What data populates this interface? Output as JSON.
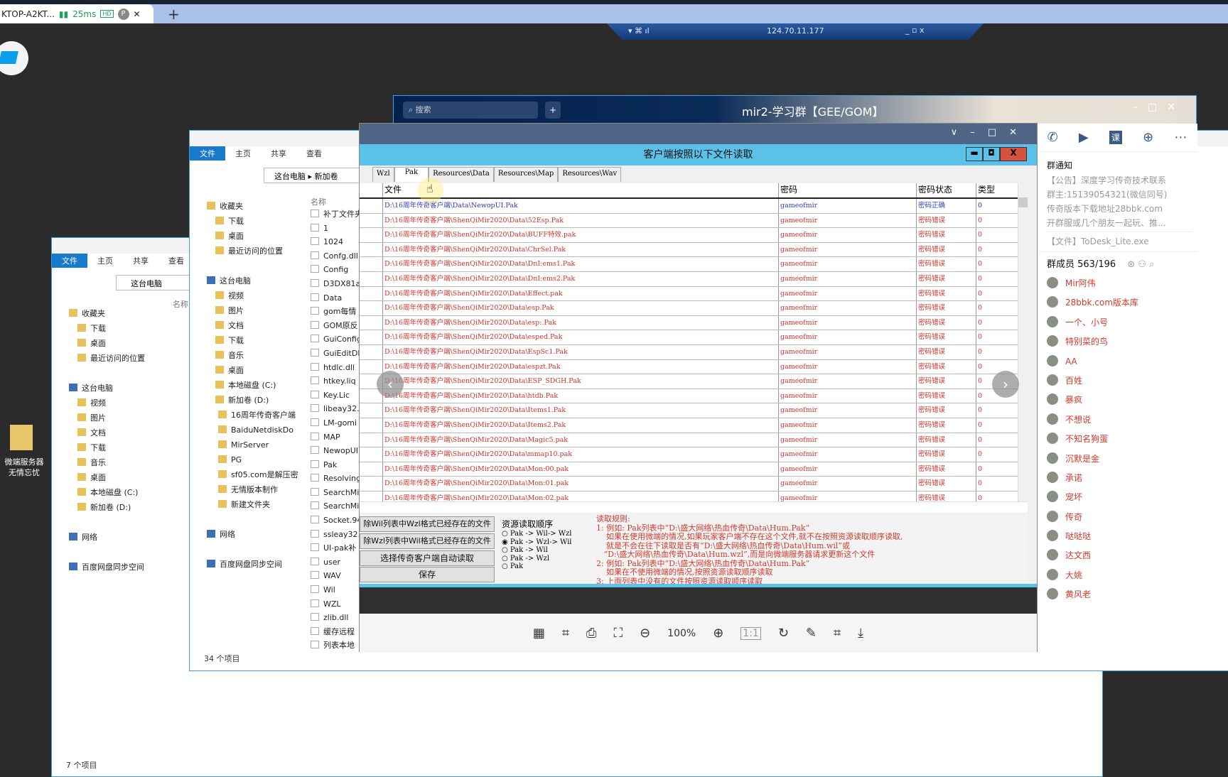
{
  "browser": {
    "tab_title": "KTOP-A2KT...",
    "ping": "25ms",
    "hd": "HD",
    "profile": "P",
    "close": "✕",
    "new_tab": "+"
  },
  "remote_bar": {
    "ip": "124.70.11.177",
    "controls": "_ ▫ x"
  },
  "desktop": {
    "icon_label_1": "微端服务器",
    "icon_label_2": "无情忘忧"
  },
  "explorer_back": {
    "ribbon": [
      "文件",
      "主页",
      "共享",
      "查看"
    ],
    "path": "这台电脑",
    "col": "名称",
    "nav": [
      "收藏夹",
      "下载",
      "桌面",
      "最近访问的位置",
      "",
      "这台电脑",
      "视频",
      "图片",
      "文档",
      "下载",
      "音乐",
      "桌面",
      "本地磁盘 (C:)",
      "新加卷 (D:)",
      "",
      "网络",
      "",
      "百度网盘同步空间"
    ],
    "status": "7 个项目"
  },
  "explorer": {
    "ribbon": [
      "文件",
      "主页",
      "共享",
      "查看"
    ],
    "path": "这台电脑 ▸ 新加卷",
    "col": "名称",
    "nav": [
      "收藏夹",
      "下载",
      "桌面",
      "最近访问的位置",
      "",
      "这台电脑",
      "视频",
      "图片",
      "文档",
      "下载",
      "音乐",
      "桌面",
      "本地磁盘 (C:)",
      "新加卷 (D:)",
      "16周年传奇客户端",
      "BaiduNetdiskDo",
      "MirServer",
      "PG",
      "sf05.com是解压密",
      "无情版本制作",
      "新建文件夹",
      "",
      "网络",
      "",
      "百度网盘同步空间"
    ],
    "files": [
      "补丁文件夹",
      "1",
      "1024",
      "Confg.dll",
      "Config",
      "D3DX81a",
      "Data",
      "gom每情",
      "GOM原反",
      "GuiConfig",
      "GuiEditDl",
      "htdlc.dll",
      "htkey.liq",
      "Key.Lic",
      "libeay32.",
      "LM-gomi",
      "MAP",
      "NewopUI",
      "Pak",
      "Resolving",
      "SearchMi",
      "SearchMi",
      "Socket.94",
      "ssleay32.",
      "UI-pak补",
      "user",
      "WAV",
      "Wil",
      "WZL",
      "zlib.dll",
      "缓存远程",
      "列表本地"
    ],
    "status": "34 个项目"
  },
  "qq": {
    "search_placeholder": "搜索",
    "add": "+",
    "title": "mir2-学习群【GEE/GOM】",
    "notice_title": "群通知",
    "notice_lines": [
      "【公告】深度学习传奇技术联系",
      "群主:15139054321(微信同号)",
      "传奇版本下载地址28bbk.com",
      "开群服或几个朋友一起玩、推..."
    ],
    "file_line": "【文件】ToDesk_Lite.exe",
    "members_label": "群成员 563/196",
    "members": [
      "Mir阿伟",
      "28bbk.com版本库",
      "一个、小号",
      "特别菜的鸟",
      "AA",
      "百姓",
      "暴疯",
      "不想说",
      "不知名狗蛋",
      "沉默是金",
      "承诺",
      "宠坏",
      "传奇",
      "哒哒哒",
      "达文西",
      "大姚",
      "黄风老"
    ],
    "header_icons": [
      "phone-icon",
      "video-icon",
      "course-icon",
      "add-app-icon",
      "more-icon"
    ]
  },
  "dialog": {
    "caption": "客户端按照以下文件读取",
    "tabs": [
      "Wzl",
      "Pak",
      "Resources\\Data",
      "Resources\\Map",
      "Resources\\Wav"
    ],
    "active_tab": "Pak",
    "columns": [
      "文件",
      "密码",
      "密码状态",
      "类型"
    ],
    "rows": [
      [
        "D:\\16周年传奇客户端\\Data\\NewopUI.Pak",
        "gameofmir",
        "密码正确",
        "0"
      ],
      [
        "D:\\16周年传奇客户端\\ShenQiMir2020\\Data\\52Esp.Pak",
        "gameofmir",
        "密码错误",
        "0"
      ],
      [
        "D:\\16周年传奇客户端\\ShenQiMir2020\\Data\\BUFF特效.pak",
        "gameofmir",
        "密码错误",
        "0"
      ],
      [
        "D:\\16周年传奇客户端\\ShenQiMir2020\\Data\\ChrSel.Pak",
        "gameofmir",
        "密码错误",
        "0"
      ],
      [
        "D:\\16周年传奇客户端\\ShenQiMir2020\\Data\\DnI:ems1.Pak",
        "gameofmir",
        "密码错误",
        "0"
      ],
      [
        "D:\\16周年传奇客户端\\ShenQiMir2020\\Data\\DnI:ems2.Pak",
        "gameofmir",
        "密码错误",
        "0"
      ],
      [
        "D:\\16周年传奇客户端\\ShenQiMir2020\\Data\\Effect.pak",
        "gameofmir",
        "密码错误",
        "0"
      ],
      [
        "D:\\16周年传奇客户端\\ShenQiMir2020\\Data\\esp.Pak",
        "gameofmir",
        "密码错误",
        "0"
      ],
      [
        "D:\\16周年传奇客户端\\ShenQiMir2020\\Data\\esp:.Pak",
        "gameofmir",
        "密码错误",
        "0"
      ],
      [
        "D:\\16周年传奇客户端\\ShenQiMir2020\\Data\\esped.Pak",
        "gameofmir",
        "密码错误",
        "0"
      ],
      [
        "D:\\16周年传奇客户端\\ShenQiMir2020\\Data\\EspSc1.Pak",
        "gameofmir",
        "密码错误",
        "0"
      ],
      [
        "D:\\16周年传奇客户端\\ShenQiMir2020\\Data\\espzt.Pak",
        "gameofmir",
        "密码错误",
        "0"
      ],
      [
        "D:\\16周年传奇客户端\\ShenQiMir2020\\Data\\ESP_SDGH.Pak",
        "gameofmir",
        "密码错误",
        "0"
      ],
      [
        "D:\\16周年传奇客户端\\ShenQiMir2020\\Data\\htdb.Pak",
        "gameofmir",
        "密码错误",
        "0"
      ],
      [
        "D:\\16周年传奇客户端\\ShenQiMir2020\\Data\\Items1.Pak",
        "gameofmir",
        "密码错误",
        "0"
      ],
      [
        "D:\\16周年传奇客户端\\ShenQiMir2020\\Data\\Items2.Pak",
        "gameofmir",
        "密码错误",
        "0"
      ],
      [
        "D:\\16周年传奇客户端\\ShenQiMir2020\\Data\\Magic5.pak",
        "gameofmir",
        "密码错误",
        "0"
      ],
      [
        "D:\\16周年传奇客户端\\ShenQiMir2020\\Data\\mmap10.pak",
        "gameofmir",
        "密码错误",
        "0"
      ],
      [
        "D:\\16周年传奇客户端\\ShenQiMir2020\\Data\\Mon:00.pak",
        "gameofmir",
        "密码错误",
        "0"
      ],
      [
        "D:\\16周年传奇客户端\\ShenQiMir2020\\Data\\Mon:01.pak",
        "gameofmir",
        "密码错误",
        "0"
      ],
      [
        "D:\\16周年传奇客户端\\ShenQiMir2020\\Data\\Mon:02.pak",
        "gameofmir",
        "密码错误",
        "0"
      ]
    ],
    "buttons": [
      "除Wil列表中Wzl格式已经存在的文件",
      "除Wzl列表中Wil格式已经存在的文件",
      "选择传奇客户端自动读取",
      "保存"
    ],
    "order_title": "资源读取顺序",
    "order_options": [
      "Pak -> Wil-> Wzl",
      "Pak -> Wzl-> Wil",
      "Pak -> Wil",
      "Pak -> Wzl",
      "Pak"
    ],
    "order_selected": 1,
    "rules": "读取规则:\n1: 例如: Pak列表中“D:\\盛大网络\\热血传奇\\Data\\Hum.Pak”\n    如果在使用微端的情况,如果玩家客户端不存在这个文件,就不在按照资源读取顺序读取,\n    就是不会在往下读取是否有“D:\\盛大网络\\热血传奇\\Data\\Hum.wil”或\n   “D:\\盛大网络\\热血传奇\\Data\\Hum.wzl”,而是向微端服务器请求更新这个文件\n2: 例如: Pak列表中“D:\\盛大网络\\热血传奇\\Data\\Hum.Pak”\n    如果在不使用微端的情况,按照资源读取顺序读取\n3: 上面列表中没有的文件按照资源读取顺序读取"
  },
  "viewer": {
    "zoom": "100%",
    "ratio": "1:1",
    "colors": {
      "ok": "#2a3fbf",
      "error": "#d2332a",
      "caption": "#5bc1e8"
    }
  }
}
